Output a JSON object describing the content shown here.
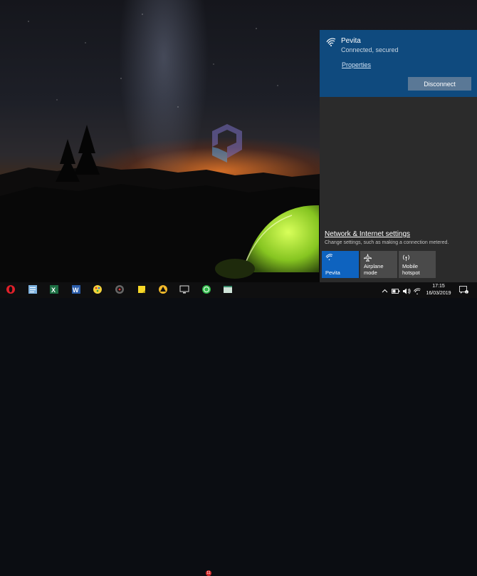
{
  "network": {
    "name": "Pevita",
    "status": "Connected, secured",
    "properties_label": "Properties",
    "disconnect_label": "Disconnect",
    "settings_link": "Network & Internet settings",
    "settings_desc": "Change settings, such as making a connection metered."
  },
  "quick_actions": [
    {
      "label": "Pevita",
      "icon": "wifi-icon",
      "active": true
    },
    {
      "label": "Airplane mode",
      "icon": "airplane-icon",
      "active": false
    },
    {
      "label_line1": "Mobile",
      "label_line2": "hotspot",
      "icon": "hotspot-icon",
      "active": false
    }
  ],
  "taskbar": {
    "apps": [
      "opera-icon",
      "notepad-icon",
      "excel-icon",
      "word-icon",
      "paint-icon",
      "camera-app-icon",
      "sticky-notes-icon",
      "drive-icon",
      "display-icon",
      "whatsapp-icon",
      "app-window-icon"
    ],
    "whatsapp_badge": "11",
    "time": "17:15",
    "date": "16/03/2019",
    "notifications_count": "1"
  },
  "colors": {
    "accent": "#0e63bf",
    "network_card": "#0f4a7e",
    "flyout_bg": "#2b2b2b",
    "taskbar_bg": "#0f0f10"
  }
}
